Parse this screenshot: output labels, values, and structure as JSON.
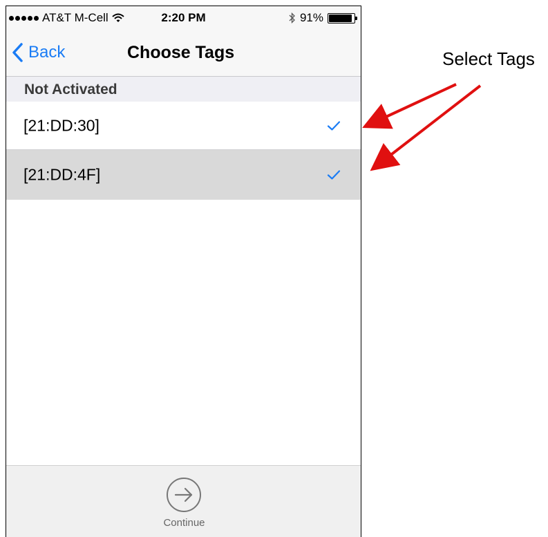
{
  "status_bar": {
    "carrier": "AT&T M-Cell",
    "time": "2:20 PM",
    "battery": "91%",
    "battery_level": 0.91,
    "signal_dots": 5
  },
  "nav": {
    "back_label": "Back",
    "title": "Choose Tags"
  },
  "section": {
    "header": "Not Activated"
  },
  "tags": [
    {
      "label": "[21:DD:30]",
      "checked": true,
      "highlighted": false
    },
    {
      "label": "[21:DD:4F]",
      "checked": true,
      "highlighted": true
    }
  ],
  "toolbar": {
    "continue_label": "Continue"
  },
  "annotation": {
    "text": "Select Tags",
    "arrow_color": "#e01010"
  },
  "colors": {
    "accent": "#1a7cf5",
    "selected_row": "#d9d9d9",
    "section_bg": "#efeff4",
    "nav_bg": "#f7f7f7"
  },
  "icons": {
    "back": "chevron-left-icon",
    "check": "checkmark-icon",
    "continue": "arrow-right-circle-icon",
    "wifi": "wifi-icon",
    "bluetooth": "bluetooth-icon",
    "battery": "battery-icon"
  }
}
